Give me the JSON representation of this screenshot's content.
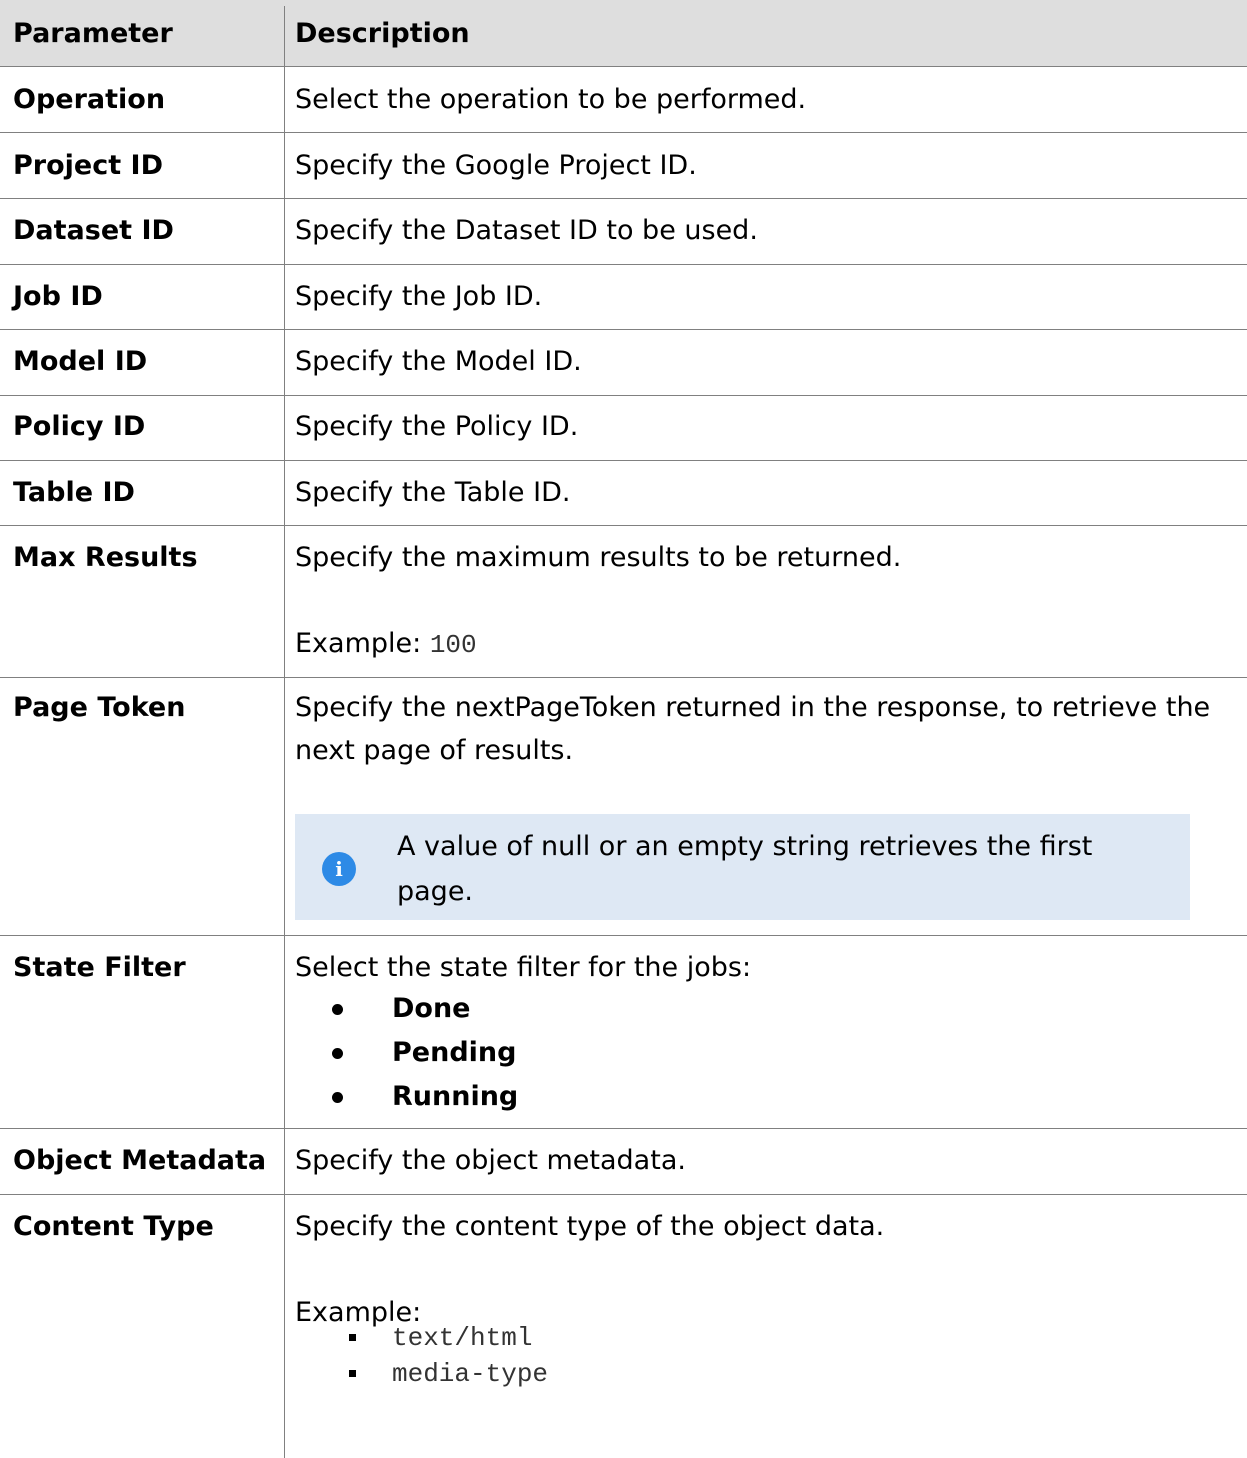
{
  "table": {
    "headers": {
      "parameter": "Parameter",
      "description": "Description"
    },
    "rows": [
      {
        "parameter": "Operation",
        "description": "Select the operation to be performed."
      },
      {
        "parameter": "Project ID",
        "description": "Specify the Google Project ID."
      },
      {
        "parameter": "Dataset ID",
        "description": "Specify the Dataset ID to be used."
      },
      {
        "parameter": "Job ID",
        "description": "Specify the Job ID."
      },
      {
        "parameter": "Model ID",
        "description": "Specify the Model ID."
      },
      {
        "parameter": "Policy ID",
        "description": "Specify the Policy ID."
      },
      {
        "parameter": "Table ID",
        "description": "Specify the Table ID."
      },
      {
        "parameter": "Max Results",
        "description": "Specify the maximum results to be returned.",
        "example_label": "Example:",
        "example_value": "100"
      },
      {
        "parameter": "Page Token",
        "description_line1": "Specify the nextPageToken returned in the response, to retrieve the",
        "description_line2": "next page of results.",
        "note_line1": "A value of null or an empty string retrieves the first",
        "note_line2": "page."
      },
      {
        "parameter": "State Filter",
        "description": "Select the state filter for the jobs:",
        "options": [
          "Done",
          "Pending",
          "Running"
        ]
      },
      {
        "parameter": "Object Metadata",
        "description": "Specify the object metadata."
      },
      {
        "parameter": "Content Type",
        "description": "Specify the content type of the object data.",
        "example_label": "Example:",
        "examples": [
          "text/html",
          "media-type"
        ]
      }
    ]
  },
  "icons": {
    "note_icon": "info-icon"
  },
  "colors": {
    "header_bg": "#dedede",
    "note_bg": "#dee8f4",
    "info_icon": "#2d8ae6",
    "border": "#808080"
  }
}
